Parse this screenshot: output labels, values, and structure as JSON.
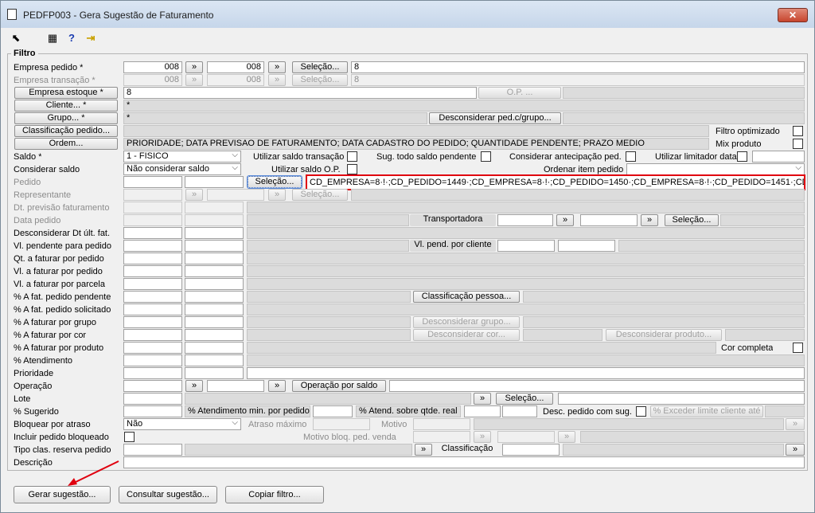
{
  "window": {
    "title": "PEDFP003 - Gera Sugestão de Faturamento",
    "close": "✕"
  },
  "toolbar": {
    "i1": "⬉",
    "i2": "▦",
    "i3": "?",
    "i4": "⇥"
  },
  "group": {
    "label": "Filtro"
  },
  "labels": {
    "empresa_pedido": "Empresa pedido *",
    "empresa_transacao": "Empresa transação *",
    "saldo": "Saldo *",
    "considerar_saldo": "Considerar saldo",
    "pedido": "Pedido",
    "representante": "Representante",
    "dt_prev": "Dt. previsão faturamento",
    "data_pedido": "Data pedido",
    "desconsiderar_dt": "Desconsiderar Dt últ. fat.",
    "vl_pendente": "Vl. pendente para pedido",
    "qt_faturar": "Qt. a faturar por pedido",
    "vl_faturar_pedido": "Vl. a faturar por pedido",
    "vl_faturar_parcela": "Vl. a faturar por parcela",
    "pct_fat_pendente": "% A fat. pedido pendente",
    "pct_fat_solicitado": "% A fat. pedido solicitado",
    "pct_grupo": "% A faturar por grupo",
    "pct_cor": "% A faturar por cor",
    "pct_produto": "% A faturar por produto",
    "pct_atendimento": "% Atendimento",
    "prioridade": "Prioridade",
    "operacao": "Operação",
    "lote": "Lote",
    "pct_sugerido": "% Sugerido",
    "bloquear_atraso": "Bloquear por atraso",
    "incluir_bloqueado": "Incluir pedido bloqueado",
    "tipo_clas": "Tipo clas. reserva pedido",
    "descricao": "Descrição",
    "filtro_optimizado": "Filtro optimizado",
    "mix_produto": "Mix produto",
    "util_saldo_transacao": "Utilizar saldo transação",
    "sug_todo_saldo": "Sug. todo saldo pendente",
    "considerar_antecipacao": "Considerar antecipação ped.",
    "util_limitador": "Utilizar limitador data",
    "util_saldo_op": "Utilizar saldo O.P.",
    "ordenar_item": "Ordenar item pedido",
    "cor_completa": "Cor completa",
    "pct_atend_min": "% Atendimento min. por pedido",
    "pct_atend_sobre": "% Atend. sobre qtde. real",
    "desc_pedido_sug": "Desc. pedido com sug.",
    "atraso_max": "Atraso máximo",
    "motivo": "Motivo",
    "motivo_bloq": "Motivo bloq. ped. venda"
  },
  "buttons": {
    "arrow": "»",
    "fade": "»",
    "selecao": "Seleção...",
    "empresa_estoque": "Empresa estoque *",
    "cliente": "Cliente... *",
    "grupo": "Grupo... *",
    "classificacao_pedido": "Classificação pedido...",
    "ordem": "Ordem...",
    "op": "O.P. ...",
    "desconsiderar_ped_grupo": "Desconsiderar ped.c/grupo...",
    "transportadora": "Transportadora",
    "vl_pend_cliente": "Vl. pend. por cliente",
    "classificacao_pessoa": "Classificação pessoa...",
    "desconsiderar_grupo": "Desconsiderar grupo...",
    "desconsiderar_cor": "Desconsiderar cor...",
    "desconsiderar_produto": "Desconsiderar produto...",
    "operacao_saldo": "Operação por saldo",
    "pct_exceder": "% Exceder limite cliente até",
    "classificacao": "Classificação",
    "gerar": "Gerar sugestão...",
    "consultar": "Consultar sugestão...",
    "copiar": "Copiar filtro..."
  },
  "values": {
    "empresa_pedido_de": "008",
    "empresa_pedido_ate": "008",
    "empresa_pedido_sel": "8",
    "empresa_trans_de": "008",
    "empresa_trans_ate": "008",
    "empresa_trans_sel": "8",
    "empresa_estoque": "8",
    "cliente": "*",
    "grupo": "*",
    "ordem": "PRIORIDADE; DATA PREVISAO DE FATURAMENTO; DATA CADASTRO DO PEDIDO; QUANTIDADE PENDENTE; PRAZO MEDIO",
    "saldo": "1 - FISICO",
    "considerar_saldo": "Não considerar saldo",
    "pedido_sel": "CD_EMPRESA=8·!·;CD_PEDIDO=1449·;CD_EMPRESA=8·!·;CD_PEDIDO=1450·;CD_EMPRESA=8·!·;CD_PEDIDO=1451·;CD_EMPRES.",
    "bloquear": "Não"
  },
  "colors": {
    "highlight": "#e0000f",
    "annotation_arrow": "#e0000f"
  }
}
